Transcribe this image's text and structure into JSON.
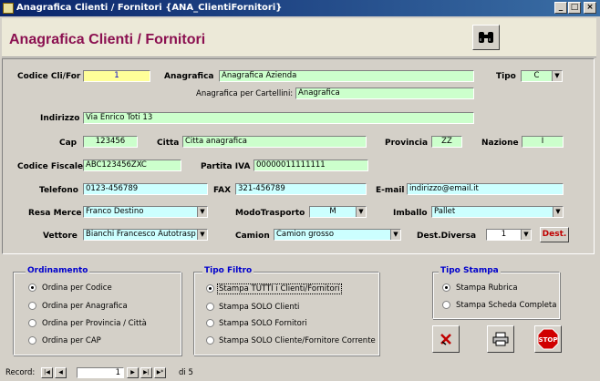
{
  "window": {
    "title": "Anagrafica Clienti / Fornitori {ANA_ClientiFornitori}",
    "minimize": "_",
    "maximize": "□",
    "close": "×"
  },
  "form": {
    "title": "Anagrafica Clienti / Fornitori"
  },
  "fields": {
    "codice_label": "Codice Cli/For",
    "codice_value": "1",
    "anagrafica_label": "Anagrafica",
    "anagrafica_value": "Anagrafica Azienda",
    "tipo_label": "Tipo",
    "tipo_value": "C",
    "cartellini_label": "Anagrafica per Cartellini:",
    "cartellini_value": "Anagrafica",
    "indirizzo_label": "Indirizzo",
    "indirizzo_value": "Via Enrico Toti 13",
    "cap_label": "Cap",
    "cap_value": "123456",
    "citta_label": "Citta",
    "citta_value": "Citta anagrafica",
    "provincia_label": "Provincia",
    "provincia_value": "ZZ",
    "nazione_label": "Nazione",
    "nazione_value": "I",
    "cf_label": "Codice Fiscale",
    "cf_value": "ABC123456ZXC",
    "piva_label": "Partita IVA",
    "piva_value": "00000011111111",
    "telefono_label": "Telefono",
    "telefono_value": "0123-456789",
    "fax_label": "FAX",
    "fax_value": "321-456789",
    "email_label": "E-mail",
    "email_value": "indirizzo@email.it",
    "resa_label": "Resa Merce",
    "resa_value": "Franco Destino",
    "modo_label": "ModoTrasporto",
    "modo_value": "M",
    "imballo_label": "Imballo",
    "imballo_value": "Pallet",
    "vettore_label": "Vettore",
    "vettore_value": "Bianchi Francesco Autotrasp",
    "camion_label": "Camion",
    "camion_value": "Camion grosso",
    "destdiv_label": "Dest.Diversa",
    "destdiv_value": "1",
    "dest_button": "Dest."
  },
  "ordinamento": {
    "title": "Ordinamento",
    "options": [
      "Ordina per Codice",
      "Ordina per Anagrafica",
      "Ordina per Provincia / Città",
      "Ordina per CAP"
    ],
    "selected": 0
  },
  "tipo_filtro": {
    "title": "Tipo Filtro",
    "options": [
      "Stampa TUTTI i Clienti/Fornitori",
      "Stampa SOLO Clienti",
      "Stampa SOLO Fornitori",
      "Stampa SOLO Cliente/Fornitore Corrente"
    ],
    "selected": 0
  },
  "tipo_stampa": {
    "title": "Tipo Stampa",
    "options": [
      "Stampa Rubrica",
      "Stampa Scheda Completa"
    ],
    "selected": 0
  },
  "buttons": {
    "stop": "STOP"
  },
  "record_nav": {
    "label": "Record:",
    "current": "1",
    "total": "di 5"
  },
  "colors": {
    "title_accent": "#8b1050",
    "group_title": "#0000cc",
    "field_green": "#ccffcc",
    "field_yellow": "#ffff99",
    "field_cyan": "#ccffff"
  }
}
